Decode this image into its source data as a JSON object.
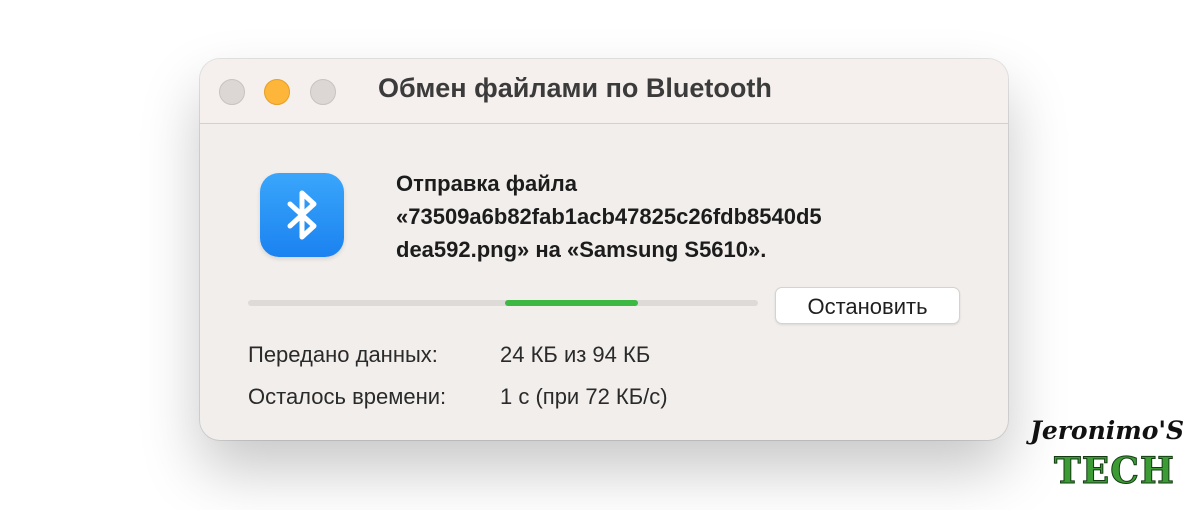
{
  "window": {
    "title": "Обмен файлами по Bluetooth",
    "controls": [
      "close",
      "minimize",
      "zoom"
    ]
  },
  "transfer": {
    "icon": "bluetooth-icon",
    "message_lines": [
      "Отправка файла",
      "«73509a6b82fab1acb47825c26fdb8540d5",
      "dea592.png» на «Samsung S5610»."
    ],
    "progress_fraction": 0.26,
    "stop_label": "Остановить",
    "sent_label": "Передано данных:",
    "sent_value": "24 КБ из 94 КБ",
    "remaining_label": "Осталось времени:",
    "remaining_value": "1 с (при 72 КБ/с)"
  },
  "watermark": {
    "line1": "Jeronimo'S",
    "line2": "TECH"
  },
  "colors": {
    "minimize": "#fdb53a",
    "progress": "#3cb843",
    "bluetooth_icon": "#1b82f0",
    "watermark_green": "#3d9b36"
  }
}
